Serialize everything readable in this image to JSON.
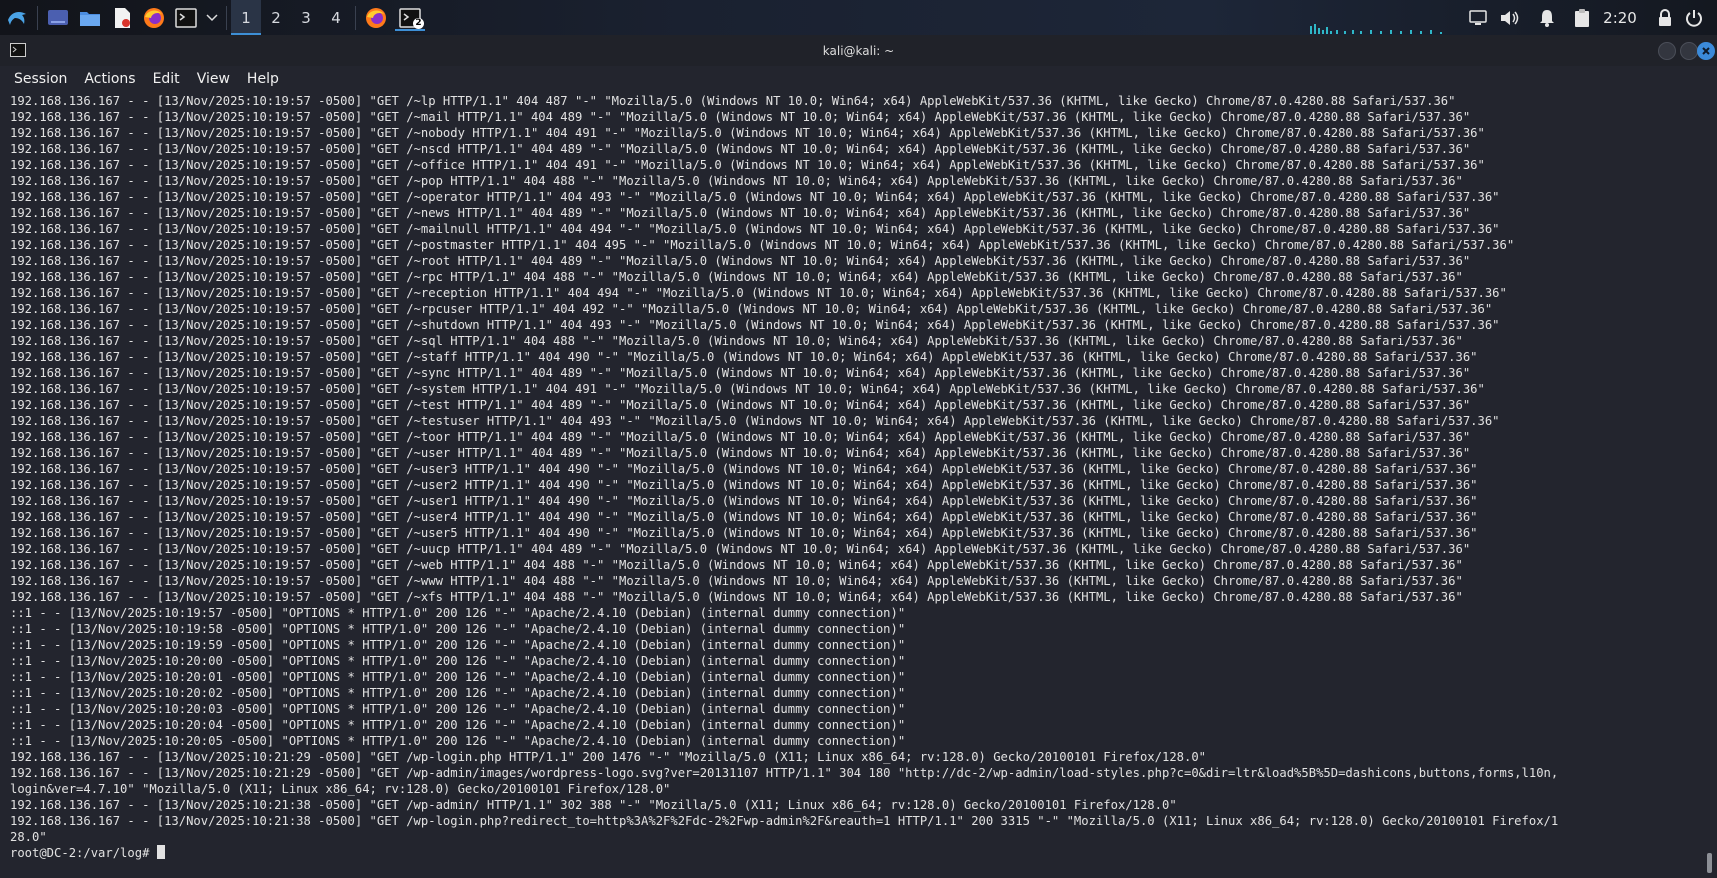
{
  "taskbar": {
    "icons": [
      "kali-menu-icon",
      "show-desktop-icon",
      "file-manager-icon",
      "text-editor-icon",
      "firefox-icon",
      "terminal-icon"
    ],
    "workspaces": [
      "1",
      "2",
      "3",
      "4"
    ],
    "active_workspace": "1",
    "terminal_badge": "2",
    "clock": "2:20",
    "tray_icons": [
      "display-icon",
      "volume-icon",
      "notification-bell-icon",
      "clipboard-icon",
      "lock-icon",
      "power-icon"
    ]
  },
  "window": {
    "title": "kali@kali: ~",
    "menu": [
      "Session",
      "Actions",
      "Edit",
      "View",
      "Help"
    ]
  },
  "terminal": {
    "lines": [
      "192.168.136.167 - - [13/Nov/2025:10:19:57 -0500] \"GET /~lp HTTP/1.1\" 404 487 \"-\" \"Mozilla/5.0 (Windows NT 10.0; Win64; x64) AppleWebKit/537.36 (KHTML, like Gecko) Chrome/87.0.4280.88 Safari/537.36\"",
      "192.168.136.167 - - [13/Nov/2025:10:19:57 -0500] \"GET /~mail HTTP/1.1\" 404 489 \"-\" \"Mozilla/5.0 (Windows NT 10.0; Win64; x64) AppleWebKit/537.36 (KHTML, like Gecko) Chrome/87.0.4280.88 Safari/537.36\"",
      "192.168.136.167 - - [13/Nov/2025:10:19:57 -0500] \"GET /~nobody HTTP/1.1\" 404 491 \"-\" \"Mozilla/5.0 (Windows NT 10.0; Win64; x64) AppleWebKit/537.36 (KHTML, like Gecko) Chrome/87.0.4280.88 Safari/537.36\"",
      "192.168.136.167 - - [13/Nov/2025:10:19:57 -0500] \"GET /~nscd HTTP/1.1\" 404 489 \"-\" \"Mozilla/5.0 (Windows NT 10.0; Win64; x64) AppleWebKit/537.36 (KHTML, like Gecko) Chrome/87.0.4280.88 Safari/537.36\"",
      "192.168.136.167 - - [13/Nov/2025:10:19:57 -0500] \"GET /~office HTTP/1.1\" 404 491 \"-\" \"Mozilla/5.0 (Windows NT 10.0; Win64; x64) AppleWebKit/537.36 (KHTML, like Gecko) Chrome/87.0.4280.88 Safari/537.36\"",
      "192.168.136.167 - - [13/Nov/2025:10:19:57 -0500] \"GET /~pop HTTP/1.1\" 404 488 \"-\" \"Mozilla/5.0 (Windows NT 10.0; Win64; x64) AppleWebKit/537.36 (KHTML, like Gecko) Chrome/87.0.4280.88 Safari/537.36\"",
      "192.168.136.167 - - [13/Nov/2025:10:19:57 -0500] \"GET /~operator HTTP/1.1\" 404 493 \"-\" \"Mozilla/5.0 (Windows NT 10.0; Win64; x64) AppleWebKit/537.36 (KHTML, like Gecko) Chrome/87.0.4280.88 Safari/537.36\"",
      "192.168.136.167 - - [13/Nov/2025:10:19:57 -0500] \"GET /~news HTTP/1.1\" 404 489 \"-\" \"Mozilla/5.0 (Windows NT 10.0; Win64; x64) AppleWebKit/537.36 (KHTML, like Gecko) Chrome/87.0.4280.88 Safari/537.36\"",
      "192.168.136.167 - - [13/Nov/2025:10:19:57 -0500] \"GET /~mailnull HTTP/1.1\" 404 494 \"-\" \"Mozilla/5.0 (Windows NT 10.0; Win64; x64) AppleWebKit/537.36 (KHTML, like Gecko) Chrome/87.0.4280.88 Safari/537.36\"",
      "192.168.136.167 - - [13/Nov/2025:10:19:57 -0500] \"GET /~postmaster HTTP/1.1\" 404 495 \"-\" \"Mozilla/5.0 (Windows NT 10.0; Win64; x64) AppleWebKit/537.36 (KHTML, like Gecko) Chrome/87.0.4280.88 Safari/537.36\"",
      "192.168.136.167 - - [13/Nov/2025:10:19:57 -0500] \"GET /~root HTTP/1.1\" 404 489 \"-\" \"Mozilla/5.0 (Windows NT 10.0; Win64; x64) AppleWebKit/537.36 (KHTML, like Gecko) Chrome/87.0.4280.88 Safari/537.36\"",
      "192.168.136.167 - - [13/Nov/2025:10:19:57 -0500] \"GET /~rpc HTTP/1.1\" 404 488 \"-\" \"Mozilla/5.0 (Windows NT 10.0; Win64; x64) AppleWebKit/537.36 (KHTML, like Gecko) Chrome/87.0.4280.88 Safari/537.36\"",
      "192.168.136.167 - - [13/Nov/2025:10:19:57 -0500] \"GET /~reception HTTP/1.1\" 404 494 \"-\" \"Mozilla/5.0 (Windows NT 10.0; Win64; x64) AppleWebKit/537.36 (KHTML, like Gecko) Chrome/87.0.4280.88 Safari/537.36\"",
      "192.168.136.167 - - [13/Nov/2025:10:19:57 -0500] \"GET /~rpcuser HTTP/1.1\" 404 492 \"-\" \"Mozilla/5.0 (Windows NT 10.0; Win64; x64) AppleWebKit/537.36 (KHTML, like Gecko) Chrome/87.0.4280.88 Safari/537.36\"",
      "192.168.136.167 - - [13/Nov/2025:10:19:57 -0500] \"GET /~shutdown HTTP/1.1\" 404 493 \"-\" \"Mozilla/5.0 (Windows NT 10.0; Win64; x64) AppleWebKit/537.36 (KHTML, like Gecko) Chrome/87.0.4280.88 Safari/537.36\"",
      "192.168.136.167 - - [13/Nov/2025:10:19:57 -0500] \"GET /~sql HTTP/1.1\" 404 488 \"-\" \"Mozilla/5.0 (Windows NT 10.0; Win64; x64) AppleWebKit/537.36 (KHTML, like Gecko) Chrome/87.0.4280.88 Safari/537.36\"",
      "192.168.136.167 - - [13/Nov/2025:10:19:57 -0500] \"GET /~staff HTTP/1.1\" 404 490 \"-\" \"Mozilla/5.0 (Windows NT 10.0; Win64; x64) AppleWebKit/537.36 (KHTML, like Gecko) Chrome/87.0.4280.88 Safari/537.36\"",
      "192.168.136.167 - - [13/Nov/2025:10:19:57 -0500] \"GET /~sync HTTP/1.1\" 404 489 \"-\" \"Mozilla/5.0 (Windows NT 10.0; Win64; x64) AppleWebKit/537.36 (KHTML, like Gecko) Chrome/87.0.4280.88 Safari/537.36\"",
      "192.168.136.167 - - [13/Nov/2025:10:19:57 -0500] \"GET /~system HTTP/1.1\" 404 491 \"-\" \"Mozilla/5.0 (Windows NT 10.0; Win64; x64) AppleWebKit/537.36 (KHTML, like Gecko) Chrome/87.0.4280.88 Safari/537.36\"",
      "192.168.136.167 - - [13/Nov/2025:10:19:57 -0500] \"GET /~test HTTP/1.1\" 404 489 \"-\" \"Mozilla/5.0 (Windows NT 10.0; Win64; x64) AppleWebKit/537.36 (KHTML, like Gecko) Chrome/87.0.4280.88 Safari/537.36\"",
      "192.168.136.167 - - [13/Nov/2025:10:19:57 -0500] \"GET /~testuser HTTP/1.1\" 404 493 \"-\" \"Mozilla/5.0 (Windows NT 10.0; Win64; x64) AppleWebKit/537.36 (KHTML, like Gecko) Chrome/87.0.4280.88 Safari/537.36\"",
      "192.168.136.167 - - [13/Nov/2025:10:19:57 -0500] \"GET /~toor HTTP/1.1\" 404 489 \"-\" \"Mozilla/5.0 (Windows NT 10.0; Win64; x64) AppleWebKit/537.36 (KHTML, like Gecko) Chrome/87.0.4280.88 Safari/537.36\"",
      "192.168.136.167 - - [13/Nov/2025:10:19:57 -0500] \"GET /~user HTTP/1.1\" 404 489 \"-\" \"Mozilla/5.0 (Windows NT 10.0; Win64; x64) AppleWebKit/537.36 (KHTML, like Gecko) Chrome/87.0.4280.88 Safari/537.36\"",
      "192.168.136.167 - - [13/Nov/2025:10:19:57 -0500] \"GET /~user3 HTTP/1.1\" 404 490 \"-\" \"Mozilla/5.0 (Windows NT 10.0; Win64; x64) AppleWebKit/537.36 (KHTML, like Gecko) Chrome/87.0.4280.88 Safari/537.36\"",
      "192.168.136.167 - - [13/Nov/2025:10:19:57 -0500] \"GET /~user2 HTTP/1.1\" 404 490 \"-\" \"Mozilla/5.0 (Windows NT 10.0; Win64; x64) AppleWebKit/537.36 (KHTML, like Gecko) Chrome/87.0.4280.88 Safari/537.36\"",
      "192.168.136.167 - - [13/Nov/2025:10:19:57 -0500] \"GET /~user1 HTTP/1.1\" 404 490 \"-\" \"Mozilla/5.0 (Windows NT 10.0; Win64; x64) AppleWebKit/537.36 (KHTML, like Gecko) Chrome/87.0.4280.88 Safari/537.36\"",
      "192.168.136.167 - - [13/Nov/2025:10:19:57 -0500] \"GET /~user4 HTTP/1.1\" 404 490 \"-\" \"Mozilla/5.0 (Windows NT 10.0; Win64; x64) AppleWebKit/537.36 (KHTML, like Gecko) Chrome/87.0.4280.88 Safari/537.36\"",
      "192.168.136.167 - - [13/Nov/2025:10:19:57 -0500] \"GET /~user5 HTTP/1.1\" 404 490 \"-\" \"Mozilla/5.0 (Windows NT 10.0; Win64; x64) AppleWebKit/537.36 (KHTML, like Gecko) Chrome/87.0.4280.88 Safari/537.36\"",
      "192.168.136.167 - - [13/Nov/2025:10:19:57 -0500] \"GET /~uucp HTTP/1.1\" 404 489 \"-\" \"Mozilla/5.0 (Windows NT 10.0; Win64; x64) AppleWebKit/537.36 (KHTML, like Gecko) Chrome/87.0.4280.88 Safari/537.36\"",
      "192.168.136.167 - - [13/Nov/2025:10:19:57 -0500] \"GET /~web HTTP/1.1\" 404 488 \"-\" \"Mozilla/5.0 (Windows NT 10.0; Win64; x64) AppleWebKit/537.36 (KHTML, like Gecko) Chrome/87.0.4280.88 Safari/537.36\"",
      "192.168.136.167 - - [13/Nov/2025:10:19:57 -0500] \"GET /~www HTTP/1.1\" 404 488 \"-\" \"Mozilla/5.0 (Windows NT 10.0; Win64; x64) AppleWebKit/537.36 (KHTML, like Gecko) Chrome/87.0.4280.88 Safari/537.36\"",
      "192.168.136.167 - - [13/Nov/2025:10:19:57 -0500] \"GET /~xfs HTTP/1.1\" 404 488 \"-\" \"Mozilla/5.0 (Windows NT 10.0; Win64; x64) AppleWebKit/537.36 (KHTML, like Gecko) Chrome/87.0.4280.88 Safari/537.36\"",
      "::1 - - [13/Nov/2025:10:19:57 -0500] \"OPTIONS * HTTP/1.0\" 200 126 \"-\" \"Apache/2.4.10 (Debian) (internal dummy connection)\"",
      "::1 - - [13/Nov/2025:10:19:58 -0500] \"OPTIONS * HTTP/1.0\" 200 126 \"-\" \"Apache/2.4.10 (Debian) (internal dummy connection)\"",
      "::1 - - [13/Nov/2025:10:19:59 -0500] \"OPTIONS * HTTP/1.0\" 200 126 \"-\" \"Apache/2.4.10 (Debian) (internal dummy connection)\"",
      "::1 - - [13/Nov/2025:10:20:00 -0500] \"OPTIONS * HTTP/1.0\" 200 126 \"-\" \"Apache/2.4.10 (Debian) (internal dummy connection)\"",
      "::1 - - [13/Nov/2025:10:20:01 -0500] \"OPTIONS * HTTP/1.0\" 200 126 \"-\" \"Apache/2.4.10 (Debian) (internal dummy connection)\"",
      "::1 - - [13/Nov/2025:10:20:02 -0500] \"OPTIONS * HTTP/1.0\" 200 126 \"-\" \"Apache/2.4.10 (Debian) (internal dummy connection)\"",
      "::1 - - [13/Nov/2025:10:20:03 -0500] \"OPTIONS * HTTP/1.0\" 200 126 \"-\" \"Apache/2.4.10 (Debian) (internal dummy connection)\"",
      "::1 - - [13/Nov/2025:10:20:04 -0500] \"OPTIONS * HTTP/1.0\" 200 126 \"-\" \"Apache/2.4.10 (Debian) (internal dummy connection)\"",
      "::1 - - [13/Nov/2025:10:20:05 -0500] \"OPTIONS * HTTP/1.0\" 200 126 \"-\" \"Apache/2.4.10 (Debian) (internal dummy connection)\"",
      "192.168.136.167 - - [13/Nov/2025:10:21:29 -0500] \"GET /wp-login.php HTTP/1.1\" 200 1476 \"-\" \"Mozilla/5.0 (X11; Linux x86_64; rv:128.0) Gecko/20100101 Firefox/128.0\"",
      "192.168.136.167 - - [13/Nov/2025:10:21:29 -0500] \"GET /wp-admin/images/wordpress-logo.svg?ver=20131107 HTTP/1.1\" 304 180 \"http://dc-2/wp-admin/load-styles.php?c=0&dir=ltr&load%5B%5D=dashicons,buttons,forms,l10n,",
      "login&ver=4.7.10\" \"Mozilla/5.0 (X11; Linux x86_64; rv:128.0) Gecko/20100101 Firefox/128.0\"",
      "192.168.136.167 - - [13/Nov/2025:10:21:38 -0500] \"GET /wp-admin/ HTTP/1.1\" 302 388 \"-\" \"Mozilla/5.0 (X11; Linux x86_64; rv:128.0) Gecko/20100101 Firefox/128.0\"",
      "192.168.136.167 - - [13/Nov/2025:10:21:38 -0500] \"GET /wp-login.php?redirect_to=http%3A%2F%2Fdc-2%2Fwp-admin%2F&reauth=1 HTTP/1.1\" 200 3315 \"-\" \"Mozilla/5.0 (X11; Linux x86_64; rv:128.0) Gecko/20100101 Firefox/1",
      "28.0\""
    ],
    "prompt": "root@DC-2:/var/log# "
  },
  "colors": {
    "terminal_bg": "#23252e",
    "terminal_fg": "#e2e2e2",
    "accent": "#3d8fd6"
  }
}
